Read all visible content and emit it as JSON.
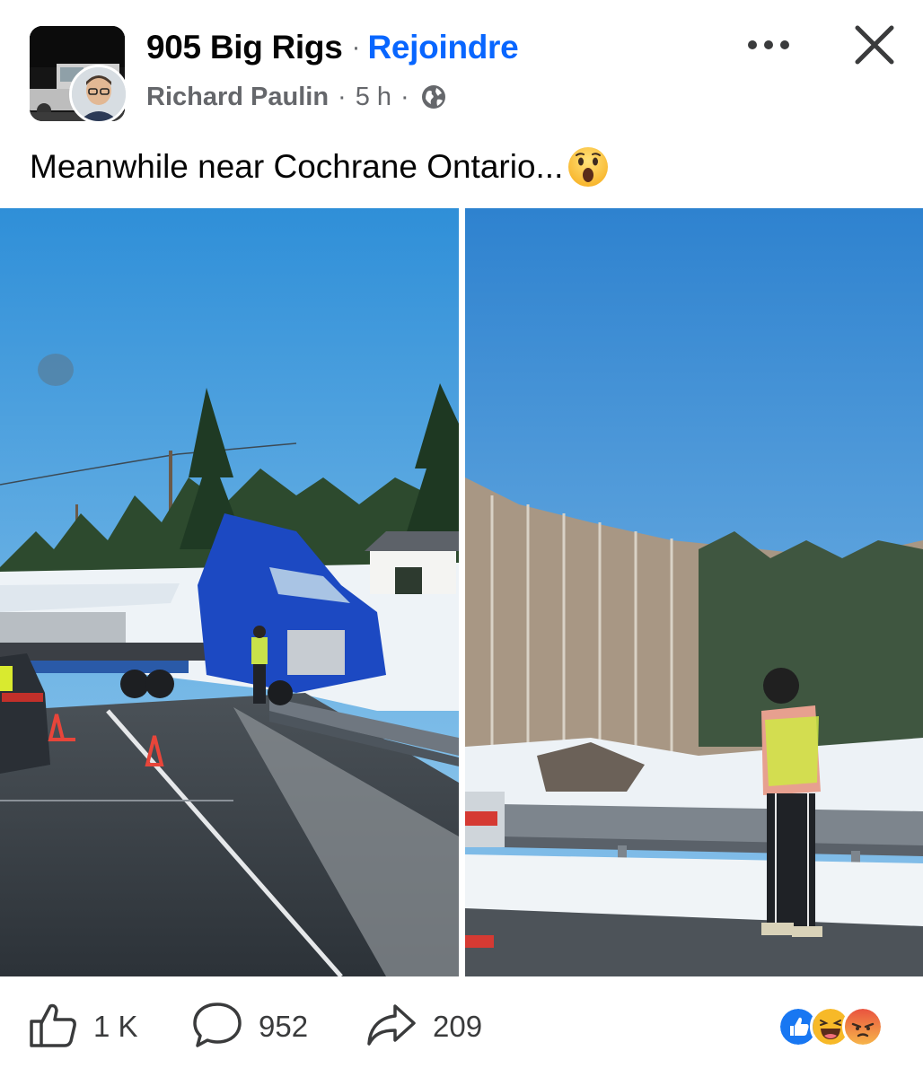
{
  "header": {
    "group_name": "905 Big Rigs",
    "separator": "·",
    "join_label": "Rejoindre",
    "author": "Richard Paulin",
    "time": "5 h",
    "audience_icon": "globe-icon"
  },
  "post": {
    "caption": "Meanwhile near Cochrane Ontario...",
    "caption_emoji": "wow-emoji"
  },
  "footer": {
    "like_count": "1 K",
    "comment_count": "952",
    "share_count": "209",
    "reactions": [
      "like",
      "haha",
      "angry"
    ]
  },
  "colors": {
    "link_blue": "#0866ff",
    "secondary_text": "#65676b",
    "primary_text": "#050505"
  }
}
